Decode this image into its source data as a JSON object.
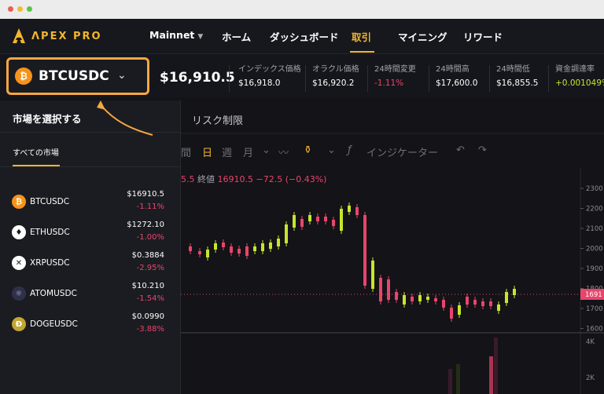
{
  "window": {
    "controls": [
      "close",
      "minimize",
      "maximize"
    ]
  },
  "nav": {
    "logo_text": "ΛPEX PRO",
    "network": "Mainnet",
    "items": [
      {
        "label": "ホーム"
      },
      {
        "label": "ダッシュボード"
      },
      {
        "label": "取引",
        "active": true
      },
      {
        "label": "マイニング"
      },
      {
        "label": "リワード"
      }
    ]
  },
  "ticker": {
    "market": "BTCUSDC",
    "market_icon": "bitcoin-icon",
    "last_price": "$16,910.5",
    "stats": [
      {
        "label": "インデックス価格",
        "value": "$16,918.0"
      },
      {
        "label": "オラクル価格",
        "value": "$16,920.2"
      },
      {
        "label": "24時間変更",
        "value": "-1.11%",
        "tone": "negative"
      },
      {
        "label": "24時間高",
        "value": "$17,600.0"
      },
      {
        "label": "24時間低",
        "value": "$16,855.5"
      },
      {
        "label": "資金調達率",
        "value": "+0.001049%",
        "tone": "positive"
      }
    ]
  },
  "chart_panel": {
    "tab": "リスク制限",
    "toolbar": {
      "time_partial": "間",
      "day": "日",
      "week": "週",
      "month": "月",
      "indicators": "インジケーター"
    },
    "ohlc_lead": "5.5",
    "close_label": "終値",
    "close_value": "16910.5",
    "change": "−72.5 (−0.43%)",
    "price_axis": [
      "2300",
      "2200",
      "2100",
      "2000",
      "1900",
      "1800",
      "1700",
      "1600"
    ],
    "current_price_tag": "1691",
    "volume_axis": [
      "4K",
      "2K"
    ]
  },
  "dropdown": {
    "title": "市場を選択する",
    "tab": "すべての市場",
    "markets": [
      {
        "symbol": "BTCUSDC",
        "price": "$16910.5",
        "change": "-1.11%",
        "icon": "bitcoin-icon",
        "color": "#f7931a"
      },
      {
        "symbol": "ETHUSDC",
        "price": "$1272.10",
        "change": "-1.00%",
        "icon": "ethereum-icon",
        "color": "#ffffff"
      },
      {
        "symbol": "XRPUSDC",
        "price": "$0.3884",
        "change": "-2.95%",
        "icon": "xrp-icon",
        "color": "#ffffff"
      },
      {
        "symbol": "ATOMUSDC",
        "price": "$10.210",
        "change": "-1.54%",
        "icon": "cosmos-atom-icon",
        "color": "#2e3148"
      },
      {
        "symbol": "DOGEUSDC",
        "price": "$0.0990",
        "change": "-3.88%",
        "icon": "dogecoin-icon",
        "color": "#c2a633"
      }
    ]
  },
  "colors": {
    "accent": "#f2b62e",
    "highlight_border": "#f5a742",
    "up": "#c7e52b",
    "down": "#e8456b"
  }
}
